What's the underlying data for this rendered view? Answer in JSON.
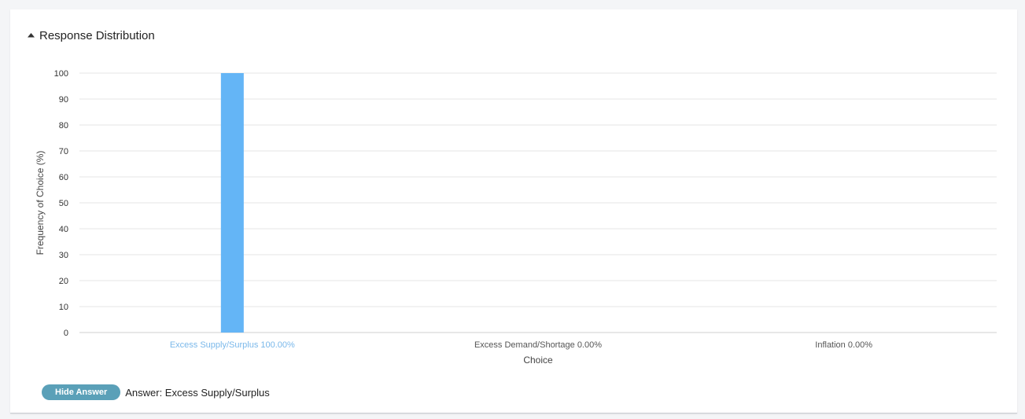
{
  "panel": {
    "title": "Response Distribution",
    "toggle_icon": "caret-up-icon"
  },
  "chart_data": {
    "type": "bar",
    "categories": [
      "Excess Supply/Surplus 100.00%",
      "Excess Demand/Shortage 0.00%",
      "Inflation 0.00%"
    ],
    "values": [
      100,
      0,
      0
    ],
    "xlabel": "Choice",
    "ylabel": "Frequency of Choice (%)",
    "ylim": [
      0,
      100
    ],
    "yticks": [
      0,
      10,
      20,
      30,
      40,
      50,
      60,
      70,
      80,
      90,
      100
    ],
    "grid": true,
    "highlighted_category": 0,
    "colors": {
      "bar": "#64b5f6",
      "highlight_label": "#7ab8ea",
      "grid": "#e4e4e4"
    }
  },
  "footer": {
    "hide_answer_label": "Hide Answer",
    "answer_text": "Answer: Excess Supply/Surplus"
  }
}
